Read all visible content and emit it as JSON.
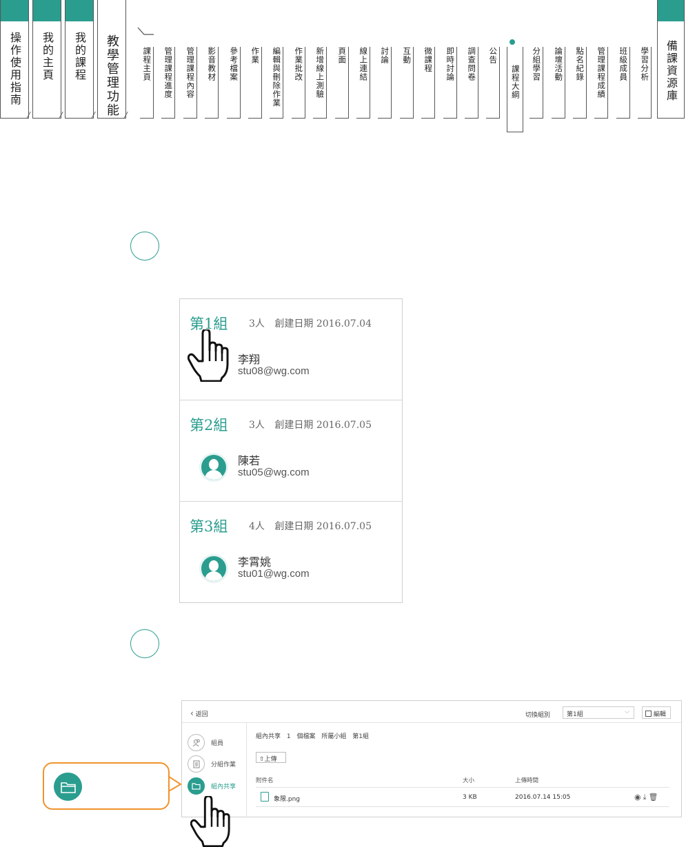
{
  "nav": {
    "big_tabs": [
      "操作使用指南",
      "我的主頁",
      "我的課程",
      "教學管理功能"
    ],
    "sub_tabs": [
      "課程主頁",
      "管理課程進度",
      "管理課程內容",
      "影音教材",
      "參考檔案",
      "作業",
      "編輯與刪除作業",
      "作業批改",
      "新增線上測驗",
      "頁面",
      "線上連結",
      "討論",
      "互動",
      "微課程",
      "即時討論",
      "調查問卷",
      "公告",
      "課程大綱",
      "分組學習",
      "論壇活動",
      "點名紀錄",
      "管理課程成績",
      "班級成員",
      "學習分析"
    ],
    "active_sub_tab": "課程大綱",
    "right_tab": "備課資源庫"
  },
  "groups": [
    {
      "title": "第1組",
      "count": "3人",
      "created": "創建日期 2016.07.04",
      "member_name": "李翔",
      "member_email": "stu08@wg.com"
    },
    {
      "title": "第2組",
      "count": "3人",
      "created": "創建日期 2016.07.05",
      "member_name": "陳若",
      "member_email": "stu05@wg.com"
    },
    {
      "title": "第3組",
      "count": "4人",
      "created": "創建日期 2016.07.05",
      "member_name": "李霄姚",
      "member_email": "stu01@wg.com"
    }
  ],
  "panel": {
    "back_label": "返回",
    "switch_label": "切換組別",
    "switch_value": "第1組",
    "edit_label": "編輯",
    "sidebar": [
      {
        "label": "組員",
        "icon": "members-icon"
      },
      {
        "label": "分組作業",
        "icon": "assignment-icon"
      },
      {
        "label": "組內共享",
        "icon": "folder-icon",
        "active": true
      }
    ],
    "info": {
      "a": "組內共享",
      "b": "1",
      "c": "個檔案",
      "d": "所屬小組",
      "e": "第1組"
    },
    "upload_label": "上傳",
    "headers": {
      "name": "附件名",
      "size": "大小",
      "time": "上傳時間"
    },
    "file": {
      "name": "象限.png",
      "size": "3 KB",
      "time": "2016.07.14 15:05"
    }
  },
  "colors": {
    "accent": "#2a9d8f",
    "callout": "#f0932b"
  }
}
